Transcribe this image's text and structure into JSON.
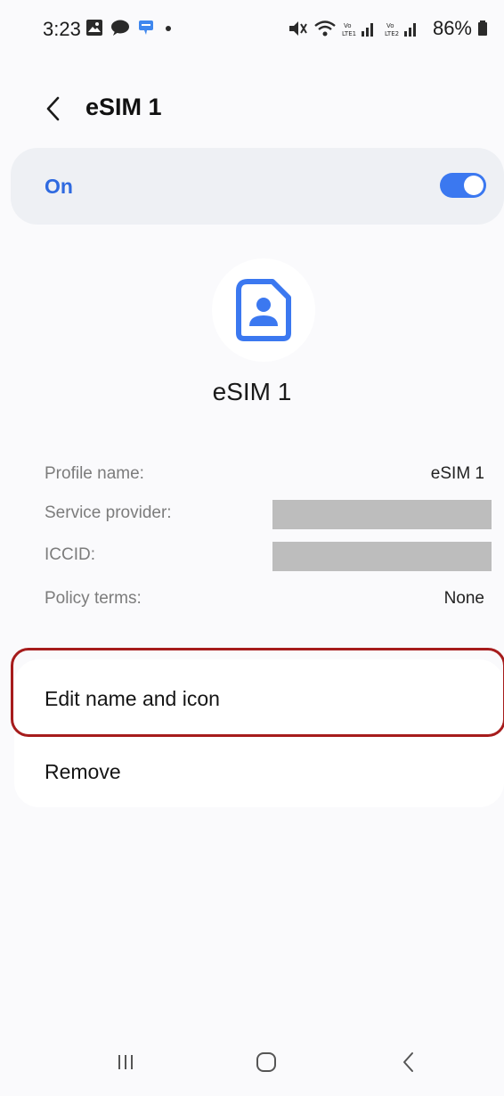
{
  "status_bar": {
    "time": "3:23",
    "battery": "86%",
    "left_icons": [
      "gallery-icon",
      "chat-icon",
      "message-icon",
      "dot-icon"
    ],
    "right_icons": [
      "mute-icon",
      "wifi-icon",
      "volte-signal-icon",
      "battery-icon"
    ]
  },
  "header": {
    "title": "eSIM 1",
    "back_icon": "chevron-left-icon"
  },
  "toggle_card": {
    "label": "On",
    "state": "on",
    "accent": "#3b78f0"
  },
  "profile": {
    "icon": "sim-contact-icon",
    "name": "eSIM 1"
  },
  "info": [
    {
      "label": "Profile name:",
      "value": "eSIM 1",
      "redacted": false
    },
    {
      "label": "Service provider:",
      "value": "",
      "redacted": true
    },
    {
      "label": "ICCID:",
      "value": "",
      "redacted": true
    },
    {
      "label": "Policy terms:",
      "value": "None",
      "redacted": false
    }
  ],
  "actions": [
    {
      "label": "Edit name and icon"
    },
    {
      "label": "Remove"
    }
  ],
  "nav": {
    "recents_icon": "recents-icon",
    "home_icon": "home-icon",
    "back_icon": "back-icon"
  }
}
